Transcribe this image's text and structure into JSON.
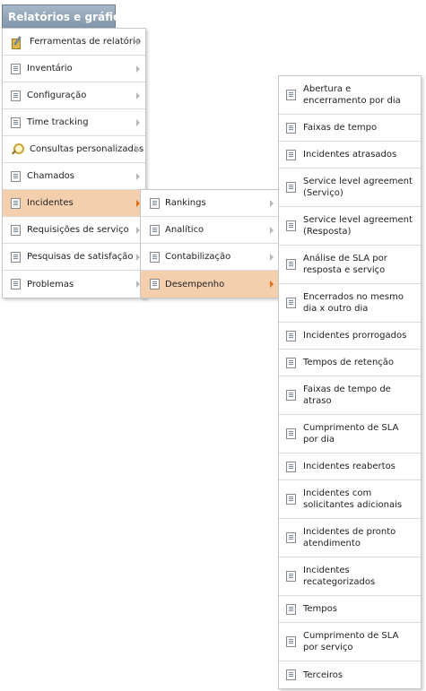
{
  "header": {
    "title": "Relatórios e gráficos"
  },
  "menu_level1": [
    {
      "label": "Ferramentas de relatório",
      "icon": "tools-icon"
    },
    {
      "label": "Inventário",
      "icon": "report-icon"
    },
    {
      "label": "Configuração",
      "icon": "report-icon"
    },
    {
      "label": "Time tracking",
      "icon": "report-icon"
    },
    {
      "label": "Consultas personalizadas",
      "icon": "search-icon"
    },
    {
      "label": "Chamados",
      "icon": "report-icon"
    },
    {
      "label": "Incidentes",
      "icon": "report-icon",
      "active": true
    },
    {
      "label": "Requisições de serviço",
      "icon": "report-icon"
    },
    {
      "label": "Pesquisas de satisfação",
      "icon": "report-icon"
    },
    {
      "label": "Problemas",
      "icon": "report-icon"
    }
  ],
  "menu_level2": [
    {
      "label": "Rankings"
    },
    {
      "label": "Analítico"
    },
    {
      "label": "Contabilização"
    },
    {
      "label": "Desempenho",
      "active": true
    }
  ],
  "menu_level3": [
    {
      "label": "Abertura e encerramento por dia"
    },
    {
      "label": "Faixas de tempo"
    },
    {
      "label": "Incidentes atrasados"
    },
    {
      "label": "Service level agreement (Serviço)"
    },
    {
      "label": "Service level agreement (Resposta)"
    },
    {
      "label": "Análise de SLA por resposta e serviço"
    },
    {
      "label": "Encerrados no mesmo dia x outro dia"
    },
    {
      "label": "Incidentes prorrogados"
    },
    {
      "label": "Tempos de retenção"
    },
    {
      "label": "Faixas de tempo de atraso"
    },
    {
      "label": "Cumprimento de SLA por dia"
    },
    {
      "label": "Incidentes reabertos"
    },
    {
      "label": "Incidentes com solicitantes adicionais"
    },
    {
      "label": "Incidentes de pronto atendimento"
    },
    {
      "label": "Incidentes recategorizados"
    },
    {
      "label": "Tempos"
    },
    {
      "label": "Cumprimento de SLA por serviço"
    },
    {
      "label": "Terceiros"
    }
  ],
  "colors": {
    "active_bg": "#f3cfad",
    "active_arrow": "#e06e10",
    "header_bg": "#8fa2b6"
  }
}
